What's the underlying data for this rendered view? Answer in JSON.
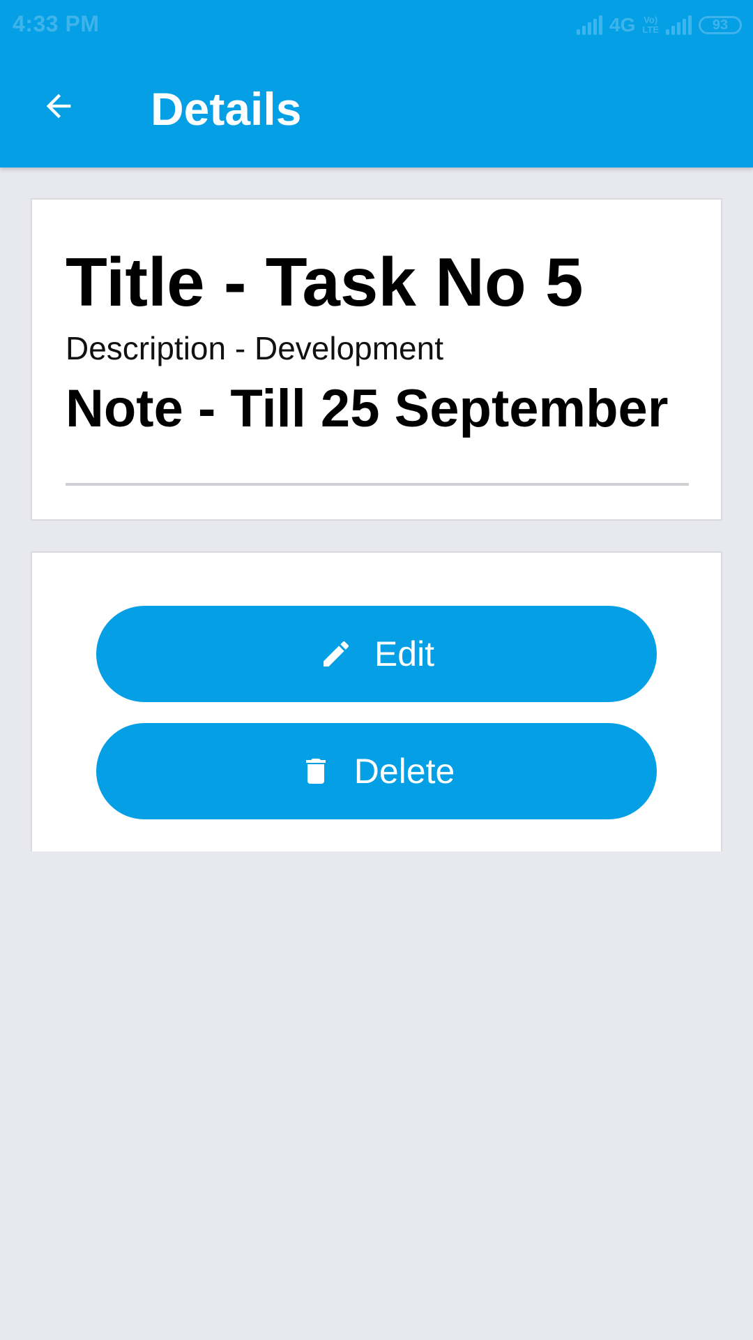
{
  "status_bar": {
    "time": "4:33 PM",
    "network": "4G",
    "volte_line1": "Vo)",
    "volte_line2": "LTE",
    "battery": "93"
  },
  "app_bar": {
    "back_icon": "arrow-left-icon",
    "title": "Details"
  },
  "task": {
    "title": "Title - Task No 5",
    "description": "Description - Development",
    "note": "Note - Till 25 September"
  },
  "actions": {
    "edit_label": "Edit",
    "edit_icon": "pencil-icon",
    "delete_label": "Delete",
    "delete_icon": "trash-icon"
  },
  "colors": {
    "primary": "#059fe5",
    "background": "#e8e8ef",
    "card": "#ffffff",
    "text": "#000000"
  }
}
